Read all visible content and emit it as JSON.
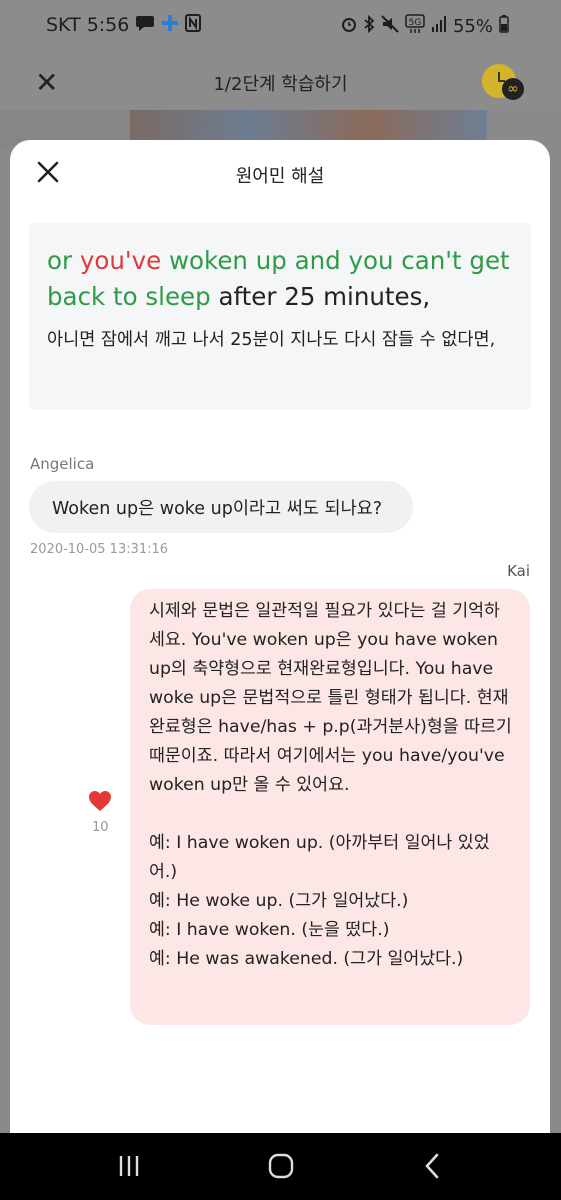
{
  "status_bar": {
    "carrier_time": "SKT 5:56",
    "battery": "55%",
    "icons": [
      "chat-icon",
      "plus-icon",
      "n-icon",
      "alarm-icon",
      "bluetooth-icon",
      "mute-icon",
      "5g-icon",
      "signal-icon",
      "battery-icon"
    ]
  },
  "background_header": {
    "close_label": "✕",
    "title": "1/2단계 학습하기",
    "timer_icon": "infinity-timer-icon",
    "timer_symbol": "∞"
  },
  "sheet": {
    "title": "원어민 해설",
    "close_icon": "close-icon"
  },
  "quote": {
    "english_segments": [
      {
        "text": "or ",
        "color": "green"
      },
      {
        "text": "you've",
        "color": "red"
      },
      {
        "text": " woken up and you can't get back to sleep",
        "color": "green"
      },
      {
        "text": " after 25 minutes,",
        "color": "black"
      }
    ],
    "korean": "아니면 잠에서 깨고 나서 25분이 지나도 다시 잠들 수 없다면,"
  },
  "comment": {
    "author": "Angelica",
    "text": "Woken up은 woke up이라고 써도 되나요?",
    "timestamp": "2020-10-05 13:31:16"
  },
  "reply": {
    "author": "Kai",
    "paragraph": "시제와 문법은 일관적일 필요가 있다는 걸 기억하세요. You've woken up은 you have woken up의 축약형으로 현재완료형입니다. You have woke up은 문법적으로 틀린 형태가 됩니다. 현재완료형은 have/has + p.p(과거분사)형을 따르기 때문이죠. 따라서 여기에서는 you have/you've woken up만 올 수 있어요.",
    "examples": [
      "예: I have woken up. (아까부터 일어나 있었어.)",
      "예: He woke up. (그가 일어났다.)",
      "예: I have woken. (눈을 떴다.)",
      "예: He was awakened. (그가 일어났다.)"
    ],
    "like_count": "10"
  },
  "colors": {
    "green": "#2f9a47",
    "red": "#e0393a",
    "reply_bubble": "#fde6e6",
    "comment_bubble": "#f0f1f3",
    "quote_card": "#f5f6f8",
    "heart": "#e53935"
  },
  "nav_bar": {
    "buttons": [
      "recent-apps-icon",
      "home-icon",
      "back-icon"
    ]
  }
}
